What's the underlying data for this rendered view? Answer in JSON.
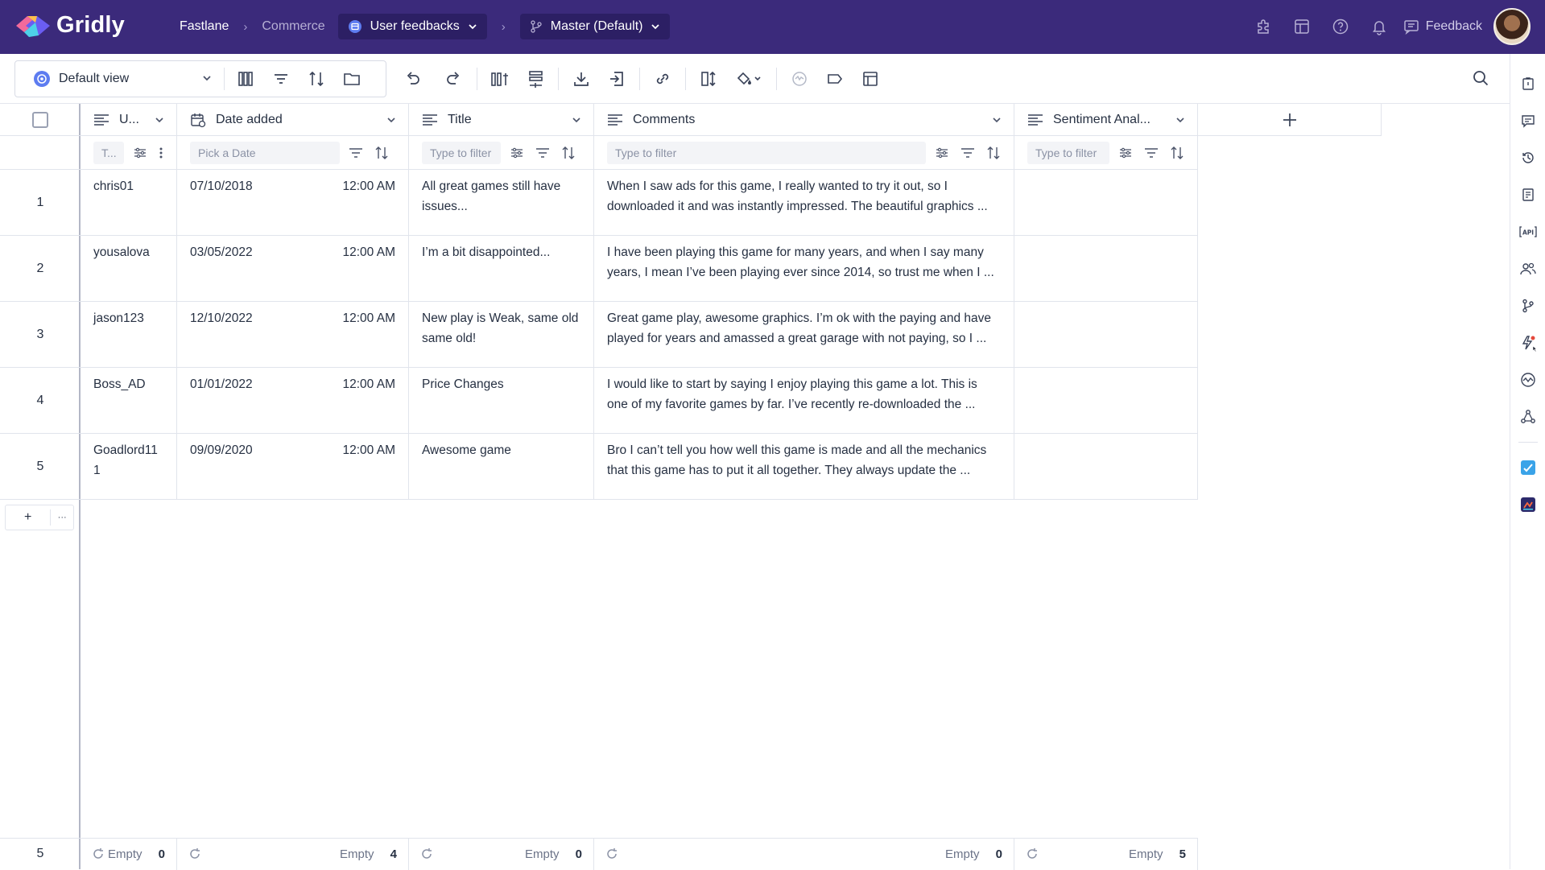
{
  "app": {
    "name": "Gridly",
    "brand_color": "#3b2a7b"
  },
  "breadcrumb": {
    "project": "Fastlane",
    "database": "Commerce",
    "grid": "User feedbacks",
    "branch": "Master (Default)"
  },
  "topbar": {
    "feedback_label": "Feedback"
  },
  "toolbar": {
    "view_label": "Default view"
  },
  "columns": [
    {
      "label": "U...",
      "filter_placeholder": "T..."
    },
    {
      "label": "Date added",
      "filter_placeholder": "Pick a Date"
    },
    {
      "label": "Title",
      "filter_placeholder": "Type to filter"
    },
    {
      "label": "Comments",
      "filter_placeholder": "Type to filter"
    },
    {
      "label": "Sentiment Anal...",
      "filter_placeholder": "Type to filter"
    }
  ],
  "rows": [
    {
      "index": "1",
      "user": "chris01",
      "date": "07/10/2018",
      "time": "12:00 AM",
      "title": "All great games still have issues...",
      "comments": "When I saw ads for this game, I really wanted to try it out, so I downloaded it and was instantly impressed. The beautiful graphics ...",
      "sentiment": ""
    },
    {
      "index": "2",
      "user": "yousalova",
      "date": "03/05/2022",
      "time": "12:00 AM",
      "title": "I’m a bit disappointed...",
      "comments": "I have been playing this game for many years, and when I say many years, I mean I’ve been playing ever since 2014, so trust me when I ...",
      "sentiment": ""
    },
    {
      "index": "3",
      "user": "jason123",
      "date": "12/10/2022",
      "time": "12:00 AM",
      "title": "New play is Weak, same old same old!",
      "comments": "Great game play, awesome graphics. I’m ok with the paying and have played for years and amassed a great garage with not paying, so I ...",
      "sentiment": ""
    },
    {
      "index": "4",
      "user": "Boss_AD",
      "date": "01/01/2022",
      "time": "12:00 AM",
      "title": "Price Changes",
      "comments": "I would like to start by saying I enjoy playing this game a lot. This is one of my favorite games by far. I’ve recently re-downloaded the ...",
      "sentiment": ""
    },
    {
      "index": "5",
      "user": "Goadlord11 1",
      "date": "09/09/2020",
      "time": "12:00 AM",
      "title": "Awesome game",
      "comments": "Bro I can’t tell you how well this game is made and all the mechanics that this game has to put it all together. They always update the ...",
      "sentiment": ""
    }
  ],
  "footer": {
    "row_count": "5",
    "empty_label": "Empty",
    "empty_counts": [
      "0",
      "4",
      "0",
      "0",
      "5"
    ]
  },
  "add_row": {
    "plus": "+",
    "more": "···"
  }
}
